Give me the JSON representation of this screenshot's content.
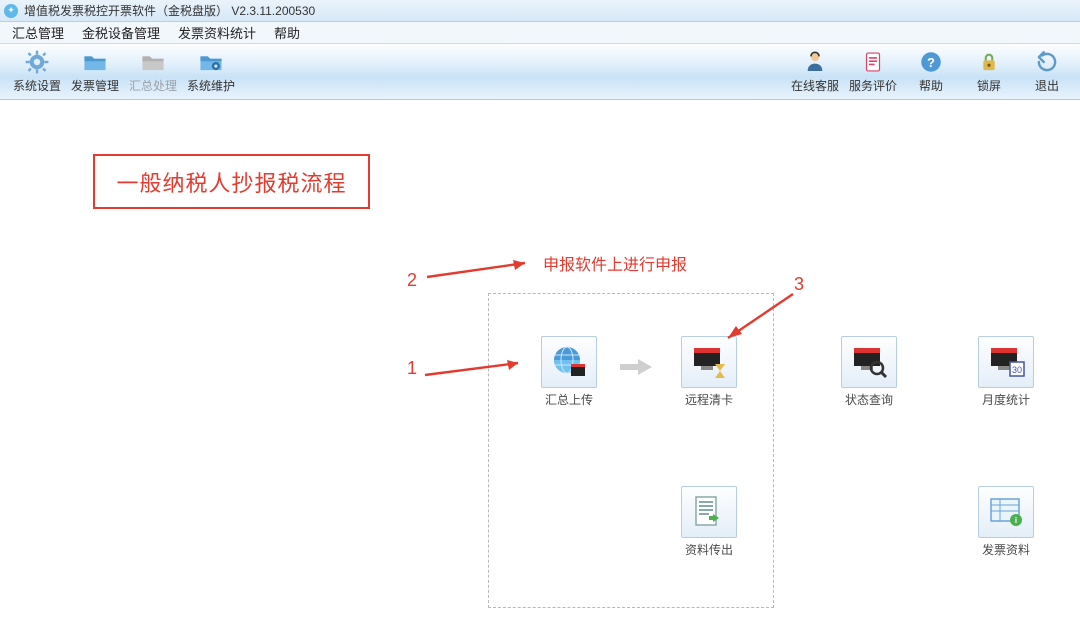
{
  "titlebar": {
    "text": "增值税发票税控开票软件（金税盘版）  V2.3.11.200530"
  },
  "menubar": {
    "items": [
      "汇总管理",
      "金税设备管理",
      "发票资料统计",
      "帮助"
    ]
  },
  "toolbar": {
    "left": [
      {
        "label": "系统设置",
        "icon": "gear"
      },
      {
        "label": "发票管理",
        "icon": "folder"
      },
      {
        "label": "汇总处理",
        "icon": "folder-disabled",
        "disabled": true
      },
      {
        "label": "系统维护",
        "icon": "folder-gear"
      }
    ],
    "right": [
      {
        "label": "在线客服",
        "icon": "support"
      },
      {
        "label": "服务评价",
        "icon": "clipboard"
      },
      {
        "label": "帮助",
        "icon": "help"
      },
      {
        "label": "锁屏",
        "icon": "lock"
      },
      {
        "label": "退出",
        "icon": "exit"
      }
    ]
  },
  "annotations": {
    "process_title": "一般纳税人抄报税流程",
    "step1": "1",
    "step2": "2",
    "step3": "3",
    "note": "申报软件上进行申报"
  },
  "tiles": {
    "upload": "汇总上传",
    "remote_clear": "远程清卡",
    "status_query": "状态查询",
    "monthly_stats": "月度统计",
    "export": "资料传出",
    "invoice_data": "发票资料"
  }
}
